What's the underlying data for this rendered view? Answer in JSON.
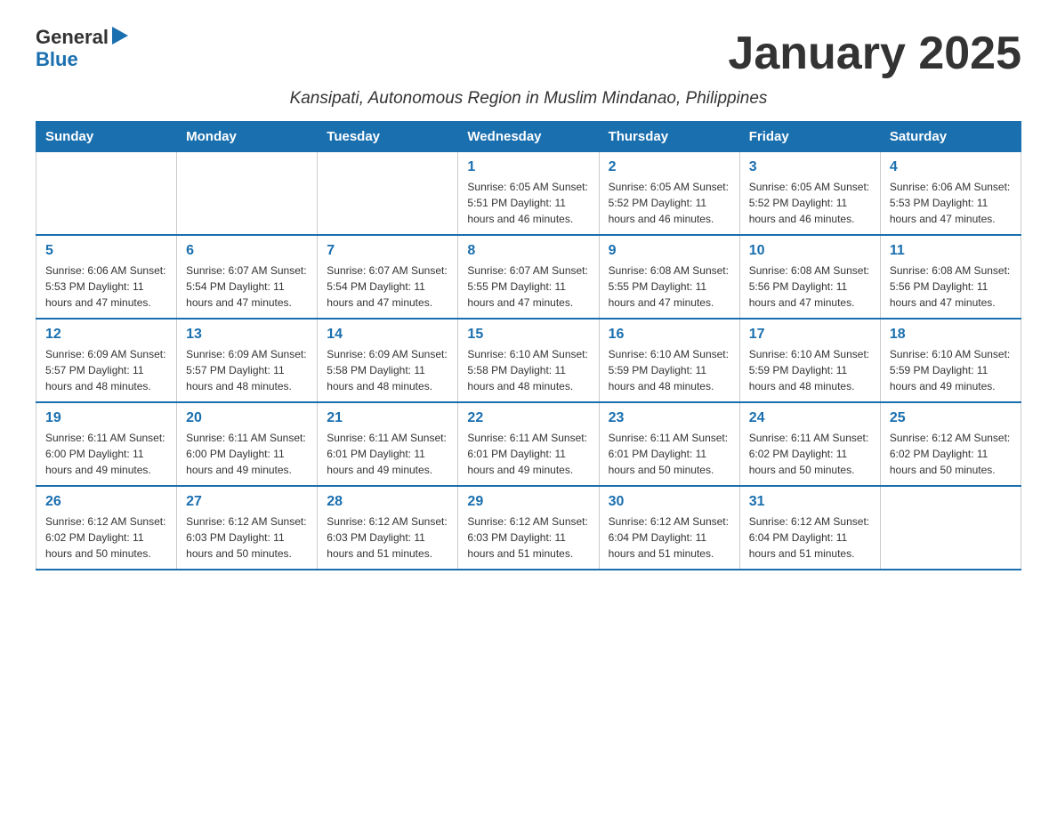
{
  "logo": {
    "general": "General",
    "blue": "Blue"
  },
  "header": {
    "month_title": "January 2025",
    "location": "Kansipati, Autonomous Region in Muslim Mindanao, Philippines"
  },
  "days_of_week": [
    "Sunday",
    "Monday",
    "Tuesday",
    "Wednesday",
    "Thursday",
    "Friday",
    "Saturday"
  ],
  "weeks": [
    [
      {
        "day": "",
        "info": ""
      },
      {
        "day": "",
        "info": ""
      },
      {
        "day": "",
        "info": ""
      },
      {
        "day": "1",
        "info": "Sunrise: 6:05 AM\nSunset: 5:51 PM\nDaylight: 11 hours and 46 minutes."
      },
      {
        "day": "2",
        "info": "Sunrise: 6:05 AM\nSunset: 5:52 PM\nDaylight: 11 hours and 46 minutes."
      },
      {
        "day": "3",
        "info": "Sunrise: 6:05 AM\nSunset: 5:52 PM\nDaylight: 11 hours and 46 minutes."
      },
      {
        "day": "4",
        "info": "Sunrise: 6:06 AM\nSunset: 5:53 PM\nDaylight: 11 hours and 47 minutes."
      }
    ],
    [
      {
        "day": "5",
        "info": "Sunrise: 6:06 AM\nSunset: 5:53 PM\nDaylight: 11 hours and 47 minutes."
      },
      {
        "day": "6",
        "info": "Sunrise: 6:07 AM\nSunset: 5:54 PM\nDaylight: 11 hours and 47 minutes."
      },
      {
        "day": "7",
        "info": "Sunrise: 6:07 AM\nSunset: 5:54 PM\nDaylight: 11 hours and 47 minutes."
      },
      {
        "day": "8",
        "info": "Sunrise: 6:07 AM\nSunset: 5:55 PM\nDaylight: 11 hours and 47 minutes."
      },
      {
        "day": "9",
        "info": "Sunrise: 6:08 AM\nSunset: 5:55 PM\nDaylight: 11 hours and 47 minutes."
      },
      {
        "day": "10",
        "info": "Sunrise: 6:08 AM\nSunset: 5:56 PM\nDaylight: 11 hours and 47 minutes."
      },
      {
        "day": "11",
        "info": "Sunrise: 6:08 AM\nSunset: 5:56 PM\nDaylight: 11 hours and 47 minutes."
      }
    ],
    [
      {
        "day": "12",
        "info": "Sunrise: 6:09 AM\nSunset: 5:57 PM\nDaylight: 11 hours and 48 minutes."
      },
      {
        "day": "13",
        "info": "Sunrise: 6:09 AM\nSunset: 5:57 PM\nDaylight: 11 hours and 48 minutes."
      },
      {
        "day": "14",
        "info": "Sunrise: 6:09 AM\nSunset: 5:58 PM\nDaylight: 11 hours and 48 minutes."
      },
      {
        "day": "15",
        "info": "Sunrise: 6:10 AM\nSunset: 5:58 PM\nDaylight: 11 hours and 48 minutes."
      },
      {
        "day": "16",
        "info": "Sunrise: 6:10 AM\nSunset: 5:59 PM\nDaylight: 11 hours and 48 minutes."
      },
      {
        "day": "17",
        "info": "Sunrise: 6:10 AM\nSunset: 5:59 PM\nDaylight: 11 hours and 48 minutes."
      },
      {
        "day": "18",
        "info": "Sunrise: 6:10 AM\nSunset: 5:59 PM\nDaylight: 11 hours and 49 minutes."
      }
    ],
    [
      {
        "day": "19",
        "info": "Sunrise: 6:11 AM\nSunset: 6:00 PM\nDaylight: 11 hours and 49 minutes."
      },
      {
        "day": "20",
        "info": "Sunrise: 6:11 AM\nSunset: 6:00 PM\nDaylight: 11 hours and 49 minutes."
      },
      {
        "day": "21",
        "info": "Sunrise: 6:11 AM\nSunset: 6:01 PM\nDaylight: 11 hours and 49 minutes."
      },
      {
        "day": "22",
        "info": "Sunrise: 6:11 AM\nSunset: 6:01 PM\nDaylight: 11 hours and 49 minutes."
      },
      {
        "day": "23",
        "info": "Sunrise: 6:11 AM\nSunset: 6:01 PM\nDaylight: 11 hours and 50 minutes."
      },
      {
        "day": "24",
        "info": "Sunrise: 6:11 AM\nSunset: 6:02 PM\nDaylight: 11 hours and 50 minutes."
      },
      {
        "day": "25",
        "info": "Sunrise: 6:12 AM\nSunset: 6:02 PM\nDaylight: 11 hours and 50 minutes."
      }
    ],
    [
      {
        "day": "26",
        "info": "Sunrise: 6:12 AM\nSunset: 6:02 PM\nDaylight: 11 hours and 50 minutes."
      },
      {
        "day": "27",
        "info": "Sunrise: 6:12 AM\nSunset: 6:03 PM\nDaylight: 11 hours and 50 minutes."
      },
      {
        "day": "28",
        "info": "Sunrise: 6:12 AM\nSunset: 6:03 PM\nDaylight: 11 hours and 51 minutes."
      },
      {
        "day": "29",
        "info": "Sunrise: 6:12 AM\nSunset: 6:03 PM\nDaylight: 11 hours and 51 minutes."
      },
      {
        "day": "30",
        "info": "Sunrise: 6:12 AM\nSunset: 6:04 PM\nDaylight: 11 hours and 51 minutes."
      },
      {
        "day": "31",
        "info": "Sunrise: 6:12 AM\nSunset: 6:04 PM\nDaylight: 11 hours and 51 minutes."
      },
      {
        "day": "",
        "info": ""
      }
    ]
  ]
}
